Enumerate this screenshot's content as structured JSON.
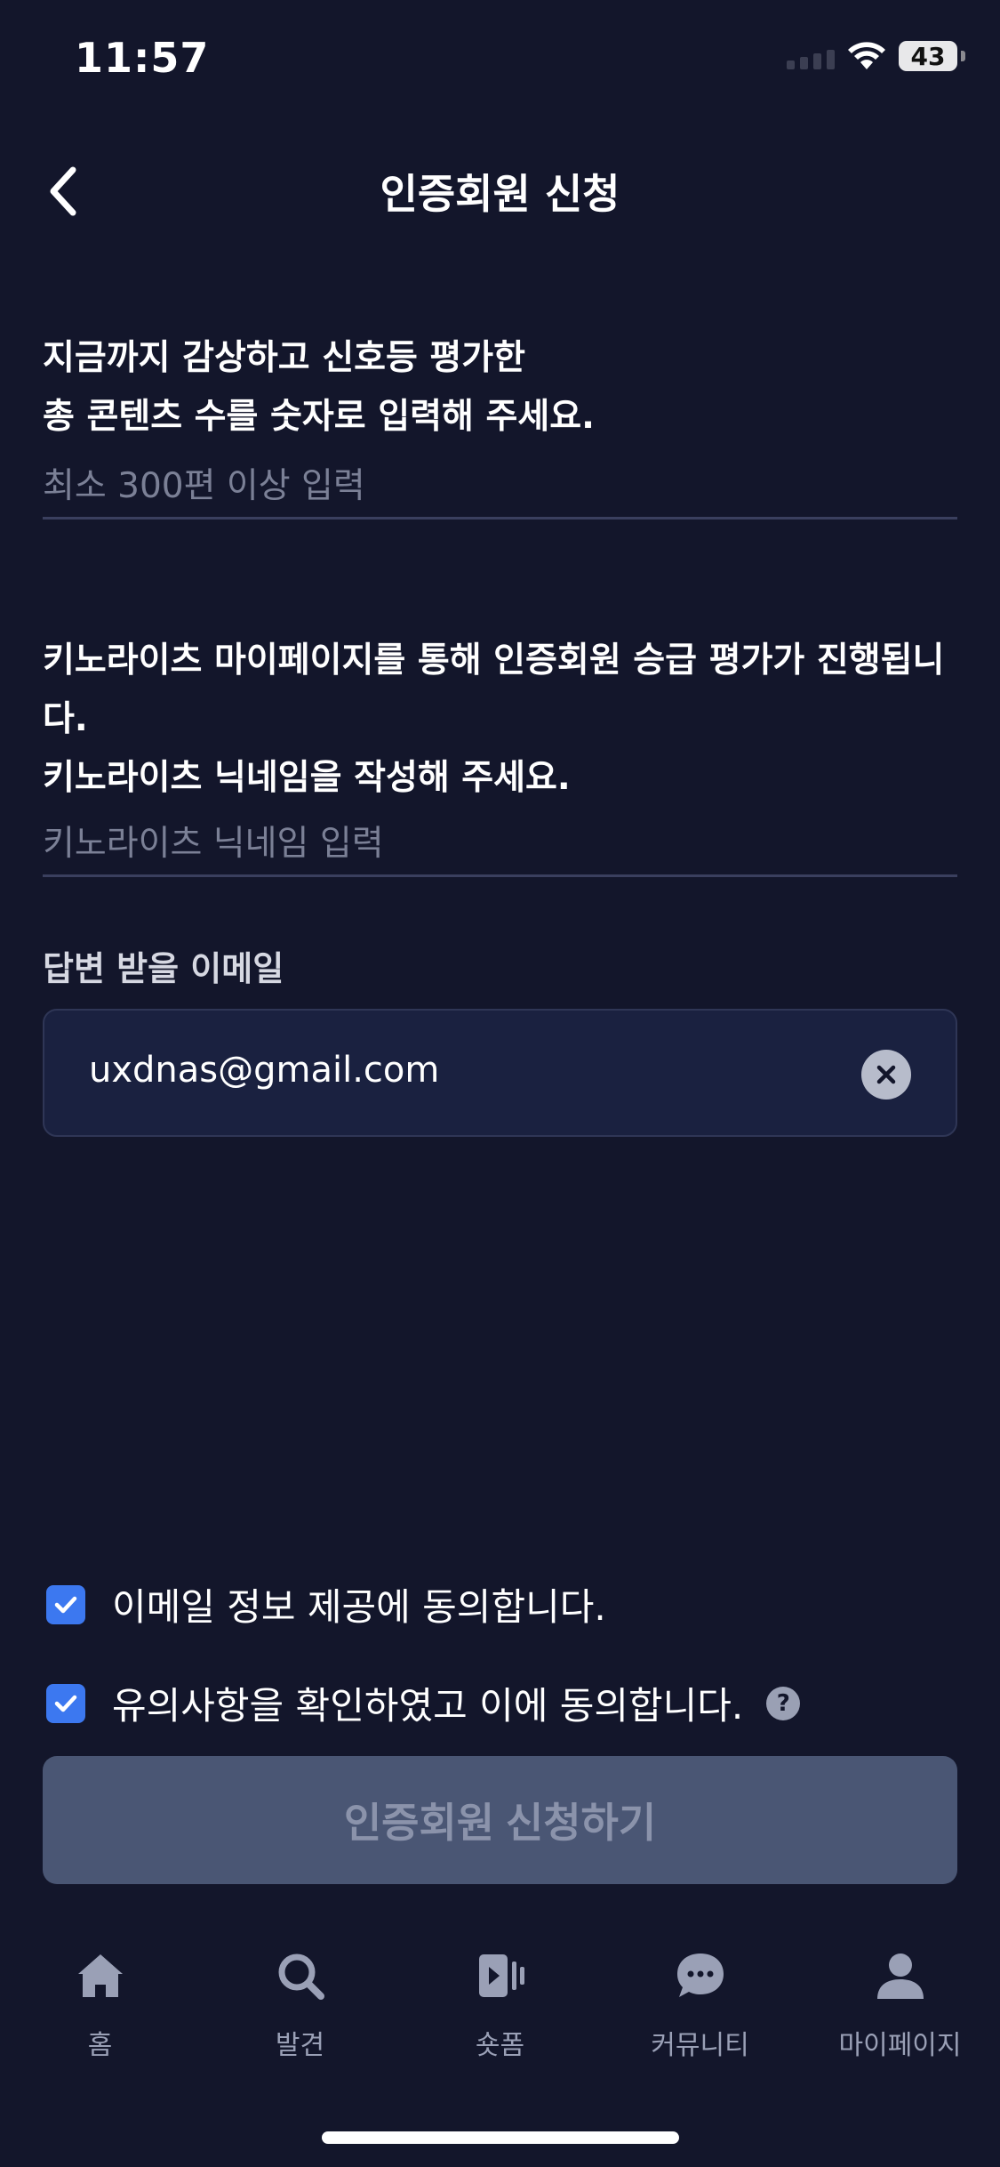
{
  "status_bar": {
    "time": "11:57",
    "battery": "43"
  },
  "header": {
    "title": "인증회원 신청"
  },
  "question1": {
    "line1": "지금까지 감상하고 신호등 평가한",
    "line2": "총 콘텐츠 수를 숫자로 입력해 주세요.",
    "placeholder": "최소 300편 이상 입력"
  },
  "question2": {
    "line1": "키노라이츠 마이페이지를 통해 인증회원 승급 평가가 진행됩니",
    "line2": "다.",
    "line3": "키노라이츠 닉네임을 작성해 주세요.",
    "placeholder": "키노라이츠 닉네임 입력"
  },
  "email": {
    "label": "답변 받을 이메일",
    "value": "uxdnas@gmail.com"
  },
  "agreements": [
    {
      "text": "이메일 정보 제공에 동의합니다.",
      "checked": true
    },
    {
      "text": "유의사항을 확인하였고 이에 동의합니다.",
      "checked": true,
      "help": "?"
    }
  ],
  "submit": {
    "label": "인증회원 신청하기"
  },
  "tabbar": [
    {
      "label": "홈",
      "icon": "home-icon"
    },
    {
      "label": "발견",
      "icon": "search-icon"
    },
    {
      "label": "숏폼",
      "icon": "shortform-icon"
    },
    {
      "label": "커뮤니티",
      "icon": "chat-icon"
    },
    {
      "label": "마이페이지",
      "icon": "person-icon"
    }
  ],
  "colors": {
    "background": "#13162b",
    "accent": "#3c78f0",
    "button_disabled": "#4a5674"
  }
}
